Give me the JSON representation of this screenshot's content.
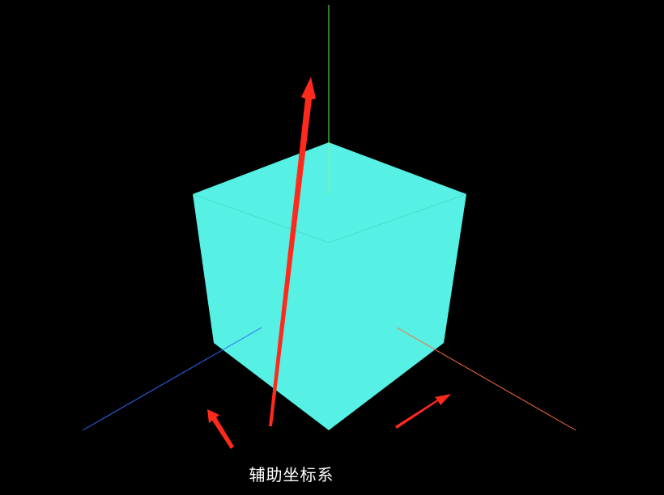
{
  "caption": "辅助坐标系",
  "colors": {
    "background": "#000000",
    "cube": "#56f0e4",
    "x_axis": "#ff6a3d",
    "y_axis": "#4cff4c",
    "z_axis": "#2a6bff",
    "annotation_arrow": "#ff2a1c",
    "caption_text": "#ffffff"
  },
  "icons": {
    "annotation": "arrow-icon"
  }
}
